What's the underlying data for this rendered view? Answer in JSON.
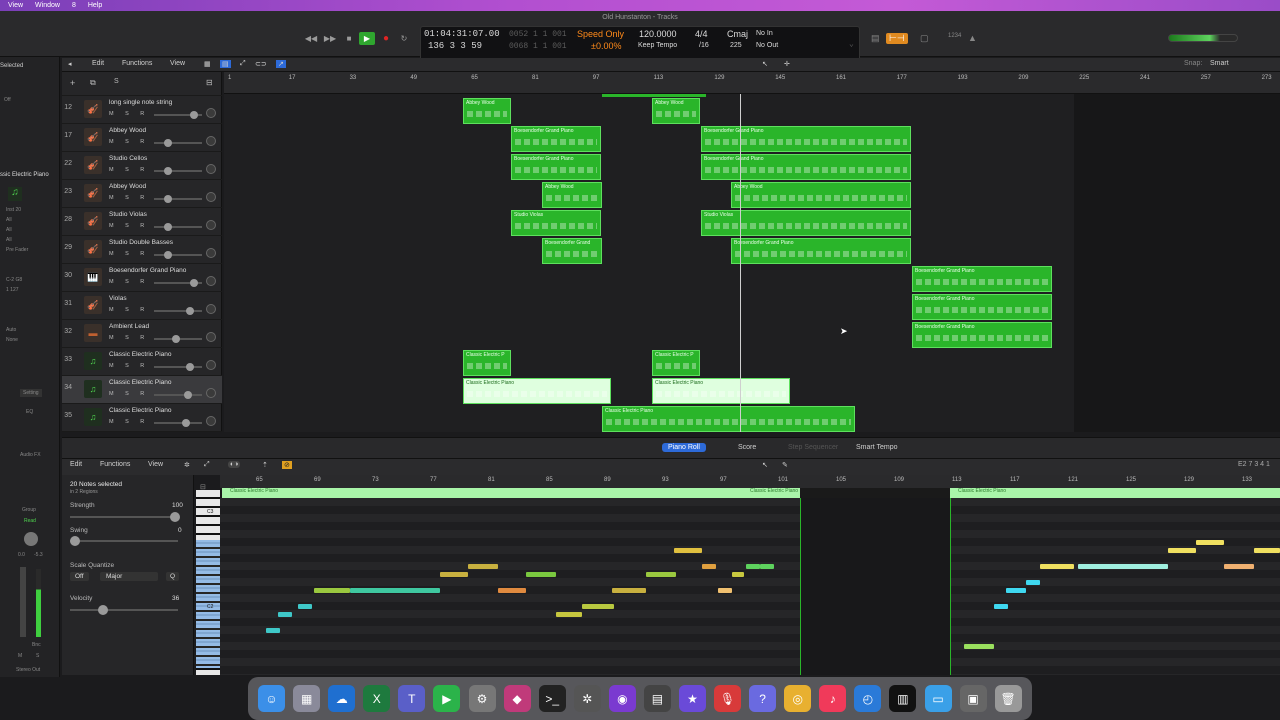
{
  "menubar": {
    "items": [
      "View",
      "Window",
      "8",
      "Help"
    ]
  },
  "window": {
    "title": "Old Hunstanton - Tracks"
  },
  "lcd": {
    "time": "01:04:31:07.00",
    "bars": "136  3  3     59",
    "ghost1": "0052  1  1  001",
    "ghost2": "0068  1  1  001",
    "speed_mode": "Speed Only",
    "speed_pct": "±0.00%",
    "tempo": "120.0000",
    "keep_tempo": "Keep Tempo",
    "sig": "4/4",
    "div": "/16",
    "key": "Cmaj",
    "key_num": "225",
    "in": "No In",
    "out": "No Out"
  },
  "control_extra": {
    "count": "1234"
  },
  "inspector": {
    "region_title": "Selected",
    "off_label": "Off",
    "track_name": "ssic Electric Piano",
    "rows": [
      "Inst 20",
      "All",
      "All",
      "All",
      "Pre Fader",
      "C-2  G8",
      "1  127",
      "Auto",
      "None"
    ],
    "setting": "Setting",
    "eq": "EQ",
    "audio_fx": "Audio FX",
    "group": "Group",
    "read": "Read",
    "vals": [
      "0.0",
      "-5.3"
    ],
    "bnc": "Bnc",
    "m": "M",
    "s": "S",
    "stereo_out": "Stereo Out"
  },
  "tracks_toolbar": {
    "edit": "Edit",
    "functions": "Functions",
    "view": "View",
    "snap_label": "Snap:",
    "snap_value": "Smart",
    "s_btn": "S"
  },
  "ruler": {
    "ticks": [
      "1",
      "17",
      "33",
      "49",
      "65",
      "81",
      "97",
      "113",
      "129",
      "145",
      "161",
      "177",
      "193",
      "209",
      "225",
      "241",
      "257",
      "273"
    ]
  },
  "tracks": [
    {
      "num": "12",
      "name": "long single note string",
      "icon": "violin-icon",
      "glyph": "🎻"
    },
    {
      "num": "17",
      "name": "Abbey Wood",
      "icon": "violin-icon",
      "glyph": "🎻"
    },
    {
      "num": "22",
      "name": "Studio Cellos",
      "icon": "cello-icon",
      "glyph": "🎻"
    },
    {
      "num": "23",
      "name": "Abbey Wood",
      "icon": "violin-icon",
      "glyph": "🎻"
    },
    {
      "num": "28",
      "name": "Studio Violas",
      "icon": "viola-icon",
      "glyph": "🎻"
    },
    {
      "num": "29",
      "name": "Studio Double Basses",
      "icon": "bass-icon",
      "glyph": "🎻"
    },
    {
      "num": "30",
      "name": "Boesendorfer Grand Piano",
      "icon": "piano-icon",
      "glyph": "🎹"
    },
    {
      "num": "31",
      "name": "Violas",
      "icon": "viola-icon",
      "glyph": "🎻"
    },
    {
      "num": "32",
      "name": "Ambient Lead",
      "icon": "synth-icon",
      "glyph": "▬"
    },
    {
      "num": "33",
      "name": "Classic Electric Piano",
      "icon": "note-icon",
      "glyph": "♫"
    },
    {
      "num": "34",
      "name": "Classic Electric Piano",
      "icon": "note-icon",
      "glyph": "♫"
    },
    {
      "num": "35",
      "name": "Classic Electric Piano",
      "icon": "note-icon",
      "glyph": "♫"
    }
  ],
  "msr": "M S R",
  "regions": [
    {
      "label": "Abbey Wood"
    },
    {
      "label": "Abbey Wood"
    },
    {
      "label": "Boesendorfer Grand Piano"
    },
    {
      "label": "Boesendorfer Grand Piano"
    },
    {
      "label": "Boesendorfer Grand Piano"
    },
    {
      "label": "Boesendorfer Grand Piano"
    },
    {
      "label": "Abbey Wood"
    },
    {
      "label": "Abbey Wood"
    },
    {
      "label": "Studio Violas"
    },
    {
      "label": "Studio Violas"
    },
    {
      "label": "Boesendorfer Grand"
    },
    {
      "label": "Boesendorfer Grand Piano"
    },
    {
      "label": "Boesendorfer Grand Piano"
    },
    {
      "label": "Boesendorfer Grand Piano"
    },
    {
      "label": "Boesendorfer Grand Piano"
    },
    {
      "label": "Classic Electric P"
    },
    {
      "label": "Classic Electric P"
    },
    {
      "label": "Classic Electric Piano"
    },
    {
      "label": "Classic Electric Piano"
    },
    {
      "label": "Classic Electric Piano"
    }
  ],
  "editor": {
    "tabs": [
      "Piano Roll",
      "Score",
      "Step Sequencer",
      "Smart Tempo"
    ],
    "edit": "Edit",
    "functions": "Functions",
    "view": "View",
    "position": "E2  7 3 4 1",
    "notes_selected": "20 Notes selected",
    "in_regions": "in 2 Regions",
    "strength_label": "Strength",
    "strength_value": "100",
    "swing_label": "Swing",
    "swing_value": "0",
    "scale_label": "Scale Quantize",
    "scale_off": "Off",
    "scale_mode": "Major",
    "q_btn": "Q",
    "velocity_label": "Velocity",
    "velocity_value": "36",
    "ruler": [
      "65",
      "69",
      "73",
      "77",
      "81",
      "85",
      "89",
      "93",
      "97",
      "101",
      "105",
      "109",
      "113",
      "117",
      "121",
      "125",
      "129",
      "133"
    ],
    "region_label": "Classic Electric Piano",
    "c3": "C3",
    "c2": "C2"
  },
  "dock": [
    {
      "name": "finder-icon",
      "glyph": "☺",
      "color": "#3b8fe8"
    },
    {
      "name": "launchpad-icon",
      "glyph": "▦",
      "color": "#8a8a9a"
    },
    {
      "name": "onedrive-icon",
      "glyph": "☁",
      "color": "#1f6fd0"
    },
    {
      "name": "excel-icon",
      "glyph": "X",
      "color": "#1e7a3e"
    },
    {
      "name": "teams-icon",
      "glyph": "T",
      "color": "#5a5fc8"
    },
    {
      "name": "facetime-icon",
      "glyph": "▶",
      "color": "#2bb34a"
    },
    {
      "name": "system-settings-icon",
      "glyph": "⚙",
      "color": "#777"
    },
    {
      "name": "shortcuts-icon",
      "glyph": "◆",
      "color": "#c03a7a"
    },
    {
      "name": "terminal-icon",
      "glyph": ">_",
      "color": "#222"
    },
    {
      "name": "compressor-icon",
      "glyph": "✲",
      "color": "#555"
    },
    {
      "name": "podcasts-icon",
      "glyph": "◉",
      "color": "#7a3ad0"
    },
    {
      "name": "calculator-icon",
      "glyph": "▤",
      "color": "#444"
    },
    {
      "name": "imovie-icon",
      "glyph": "★",
      "color": "#6a4ad8"
    },
    {
      "name": "voice-memos-icon",
      "glyph": "🎙",
      "color": "#d83a3a"
    },
    {
      "name": "help-icon",
      "glyph": "?",
      "color": "#6a6ae0"
    },
    {
      "name": "chrome-icon",
      "glyph": "◎",
      "color": "#e8b030"
    },
    {
      "name": "music-icon",
      "glyph": "♪",
      "color": "#f03a5a"
    },
    {
      "name": "safari-icon",
      "glyph": "◴",
      "color": "#2a7ad8"
    },
    {
      "name": "logic-pro-icon",
      "glyph": "▥",
      "color": "#111"
    },
    {
      "name": "folder-icon",
      "glyph": "▭",
      "color": "#3aa0e8"
    },
    {
      "name": "preview-icon",
      "glyph": "▣",
      "color": "#666"
    },
    {
      "name": "trash-icon",
      "glyph": "🗑",
      "color": "#999"
    }
  ]
}
